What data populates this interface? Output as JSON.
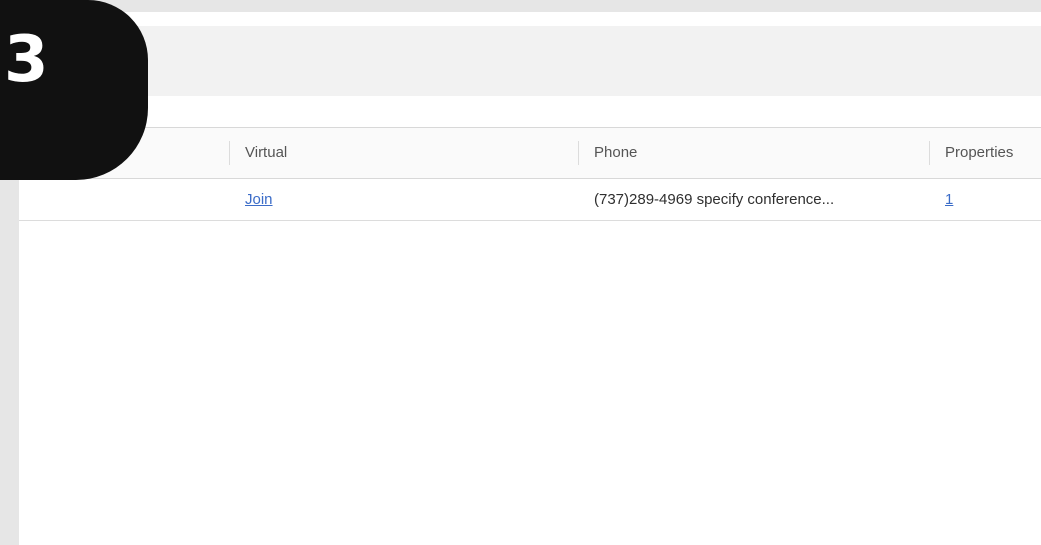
{
  "step": {
    "number": "3"
  },
  "table": {
    "headers": {
      "virtual": "Virtual",
      "phone": "Phone",
      "properties": "Properties"
    },
    "rows": [
      {
        "virtual": "Join",
        "phone": "(737)289-4969 specify conference...",
        "properties": "1"
      }
    ]
  },
  "colors": {
    "link": "#3b6cc8",
    "badge": "#111111",
    "background": "#e6e6e6"
  }
}
